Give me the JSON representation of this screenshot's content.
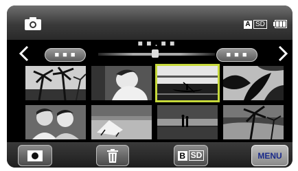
{
  "header": {
    "mode_icon": "camera-icon",
    "media_mode": "A",
    "media_slot": "SD",
    "battery_icon": "battery-icon"
  },
  "nav": {
    "prev_icon": "chevron-left-icon",
    "next_icon": "chevron-right-icon",
    "prev_date": "■ ■ ■",
    "current_date": "■ ■ . ■ ■",
    "next_date": "■ ■ ■"
  },
  "thumbnails": [
    {
      "scene": "palm-trees",
      "selected": false
    },
    {
      "scene": "person-portrait",
      "selected": false
    },
    {
      "scene": "canoe-sunset",
      "selected": true
    },
    {
      "scene": "tropical-leaves",
      "selected": false
    },
    {
      "scene": "children-smiling",
      "selected": false
    },
    {
      "scene": "beach-chair",
      "selected": false
    },
    {
      "scene": "couple-beach",
      "selected": false
    },
    {
      "scene": "palm-beach",
      "selected": false
    }
  ],
  "toolbar": {
    "record_icon": "record-icon",
    "delete_icon": "trash-icon",
    "media_b": "B",
    "media_sd": "SD",
    "menu_label": "MENU"
  },
  "colors": {
    "selection": "#c6d93a",
    "menu_text": "#1a2a8a"
  }
}
